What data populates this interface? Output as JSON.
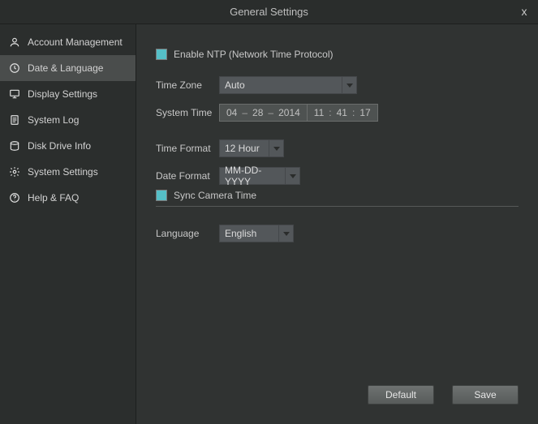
{
  "window": {
    "title": "General Settings",
    "close": "x"
  },
  "sidebar": {
    "items": [
      {
        "label": "Account Management"
      },
      {
        "label": "Date & Language"
      },
      {
        "label": "Display Settings"
      },
      {
        "label": "System Log"
      },
      {
        "label": "Disk Drive Info"
      },
      {
        "label": "System Settings"
      },
      {
        "label": "Help & FAQ"
      }
    ]
  },
  "form": {
    "ntp_label": "Enable NTP (Network Time Protocol)",
    "timezone_label": "Time Zone",
    "timezone_value": "Auto",
    "systemtime_label": "System Time",
    "date": {
      "mm": "04",
      "dd": "28",
      "yyyy": "2014",
      "sep": "–"
    },
    "time": {
      "hh": "11",
      "mm": "41",
      "ss": "17",
      "sep": ":"
    },
    "timeformat_label": "Time Format",
    "timeformat_value": "12 Hour",
    "dateformat_label": "Date Format",
    "dateformat_value": "MM-DD-YYYY",
    "sync_label": "Sync Camera Time",
    "language_label": "Language",
    "language_value": "English"
  },
  "buttons": {
    "default": "Default",
    "save": "Save"
  }
}
